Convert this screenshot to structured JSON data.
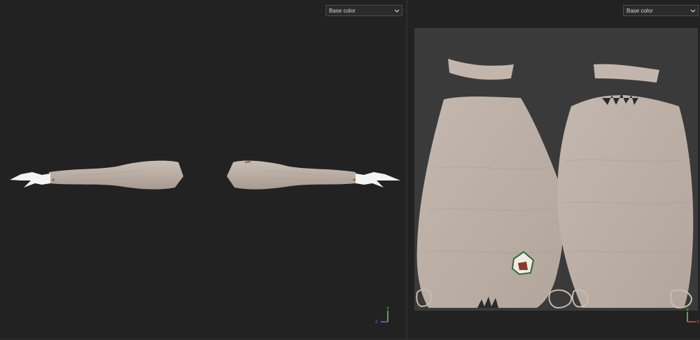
{
  "viewport_2d": {
    "channel_select": {
      "value": "Base color"
    }
  },
  "viewport_uv": {
    "channel_select": {
      "value": "Base color"
    }
  },
  "axis_gizmo_left": {
    "labels": [
      "Y",
      "Z"
    ]
  },
  "axis_gizmo_right": {
    "labels": [
      "Y",
      "X"
    ]
  },
  "colors": {
    "background": "#222222",
    "uv_sheet": "#3a3a3a",
    "skin": "#bcb0a6",
    "glove": "#ffffff",
    "axis_y": "#6fd14a",
    "axis_z": "#4d7bff",
    "axis_x": "#e05050"
  }
}
